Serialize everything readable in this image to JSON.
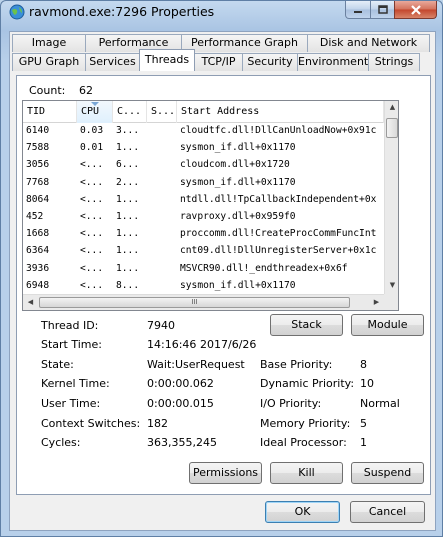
{
  "window": {
    "title": "ravmond.exe:7296 Properties"
  },
  "tabs": {
    "row1": [
      "Image",
      "Performance",
      "Performance Graph",
      "Disk and Network"
    ],
    "row2": [
      "GPU Graph",
      "Services",
      "Threads",
      "TCP/IP",
      "Security",
      "Environment",
      "Strings"
    ]
  },
  "threads": {
    "count_label": "Count:",
    "count_value": "62",
    "columns": [
      "TID",
      "CPU",
      "C...",
      "S...",
      "Start Address"
    ],
    "rows": [
      [
        "6140",
        "0.03",
        "3...",
        "",
        "cloudtfc.dll!DllCanUnloadNow+0x91c"
      ],
      [
        "7588",
        "0.01",
        "1...",
        "",
        "sysmon_if.dll+0x1170"
      ],
      [
        "3056",
        "<...",
        "6...",
        "",
        "cloudcom.dll+0x1720"
      ],
      [
        "7768",
        "<...",
        "2...",
        "",
        "sysmon_if.dll+0x1170"
      ],
      [
        "8064",
        "<...",
        "1...",
        "",
        "ntdll.dll!TpCallbackIndependent+0x"
      ],
      [
        "452",
        "<...",
        "1...",
        "",
        "ravproxy.dll+0x959f0"
      ],
      [
        "1668",
        "<...",
        "1...",
        "",
        "proccomm.dll!CreateProcCommFuncInt"
      ],
      [
        "6364",
        "<...",
        "1...",
        "",
        "cnt09.dll!DllUnregisterServer+0x1c"
      ],
      [
        "3936",
        "<...",
        "1...",
        "",
        "MSVCR90.dll!_endthreadex+0x6f"
      ],
      [
        "6948",
        "<...",
        "8...",
        "",
        "sysmon_if.dll+0x1170"
      ]
    ],
    "scroll_grip": "III"
  },
  "details": {
    "thread_id_label": "Thread ID:",
    "thread_id": "7940",
    "start_time_label": "Start Time:",
    "start_time": "14:16:46",
    "start_date": "2017/6/26",
    "state_label": "State:",
    "state": "Wait:UserRequest",
    "kernel_time_label": "Kernel Time:",
    "kernel_time": "0:00:00.062",
    "user_time_label": "User Time:",
    "user_time": "0:00:00.015",
    "context_switches_label": "Context Switches:",
    "context_switches": "182",
    "cycles_label": "Cycles:",
    "cycles": "363,355,245",
    "base_priority_label": "Base Priority:",
    "base_priority": "8",
    "dynamic_priority_label": "Dynamic Priority:",
    "dynamic_priority": "10",
    "io_priority_label": "I/O Priority:",
    "io_priority": "Normal",
    "memory_priority_label": "Memory Priority:",
    "memory_priority": "5",
    "ideal_processor_label": "Ideal Processor:",
    "ideal_processor": "1"
  },
  "buttons": {
    "stack": "Stack",
    "module": "Module",
    "permissions": "Permissions",
    "kill": "Kill",
    "suspend": "Suspend",
    "ok": "OK",
    "cancel": "Cancel"
  },
  "icons": {
    "app": "globe-icon",
    "minimize": "minimize-icon",
    "maximize": "maximize-icon",
    "close": "close-icon"
  }
}
